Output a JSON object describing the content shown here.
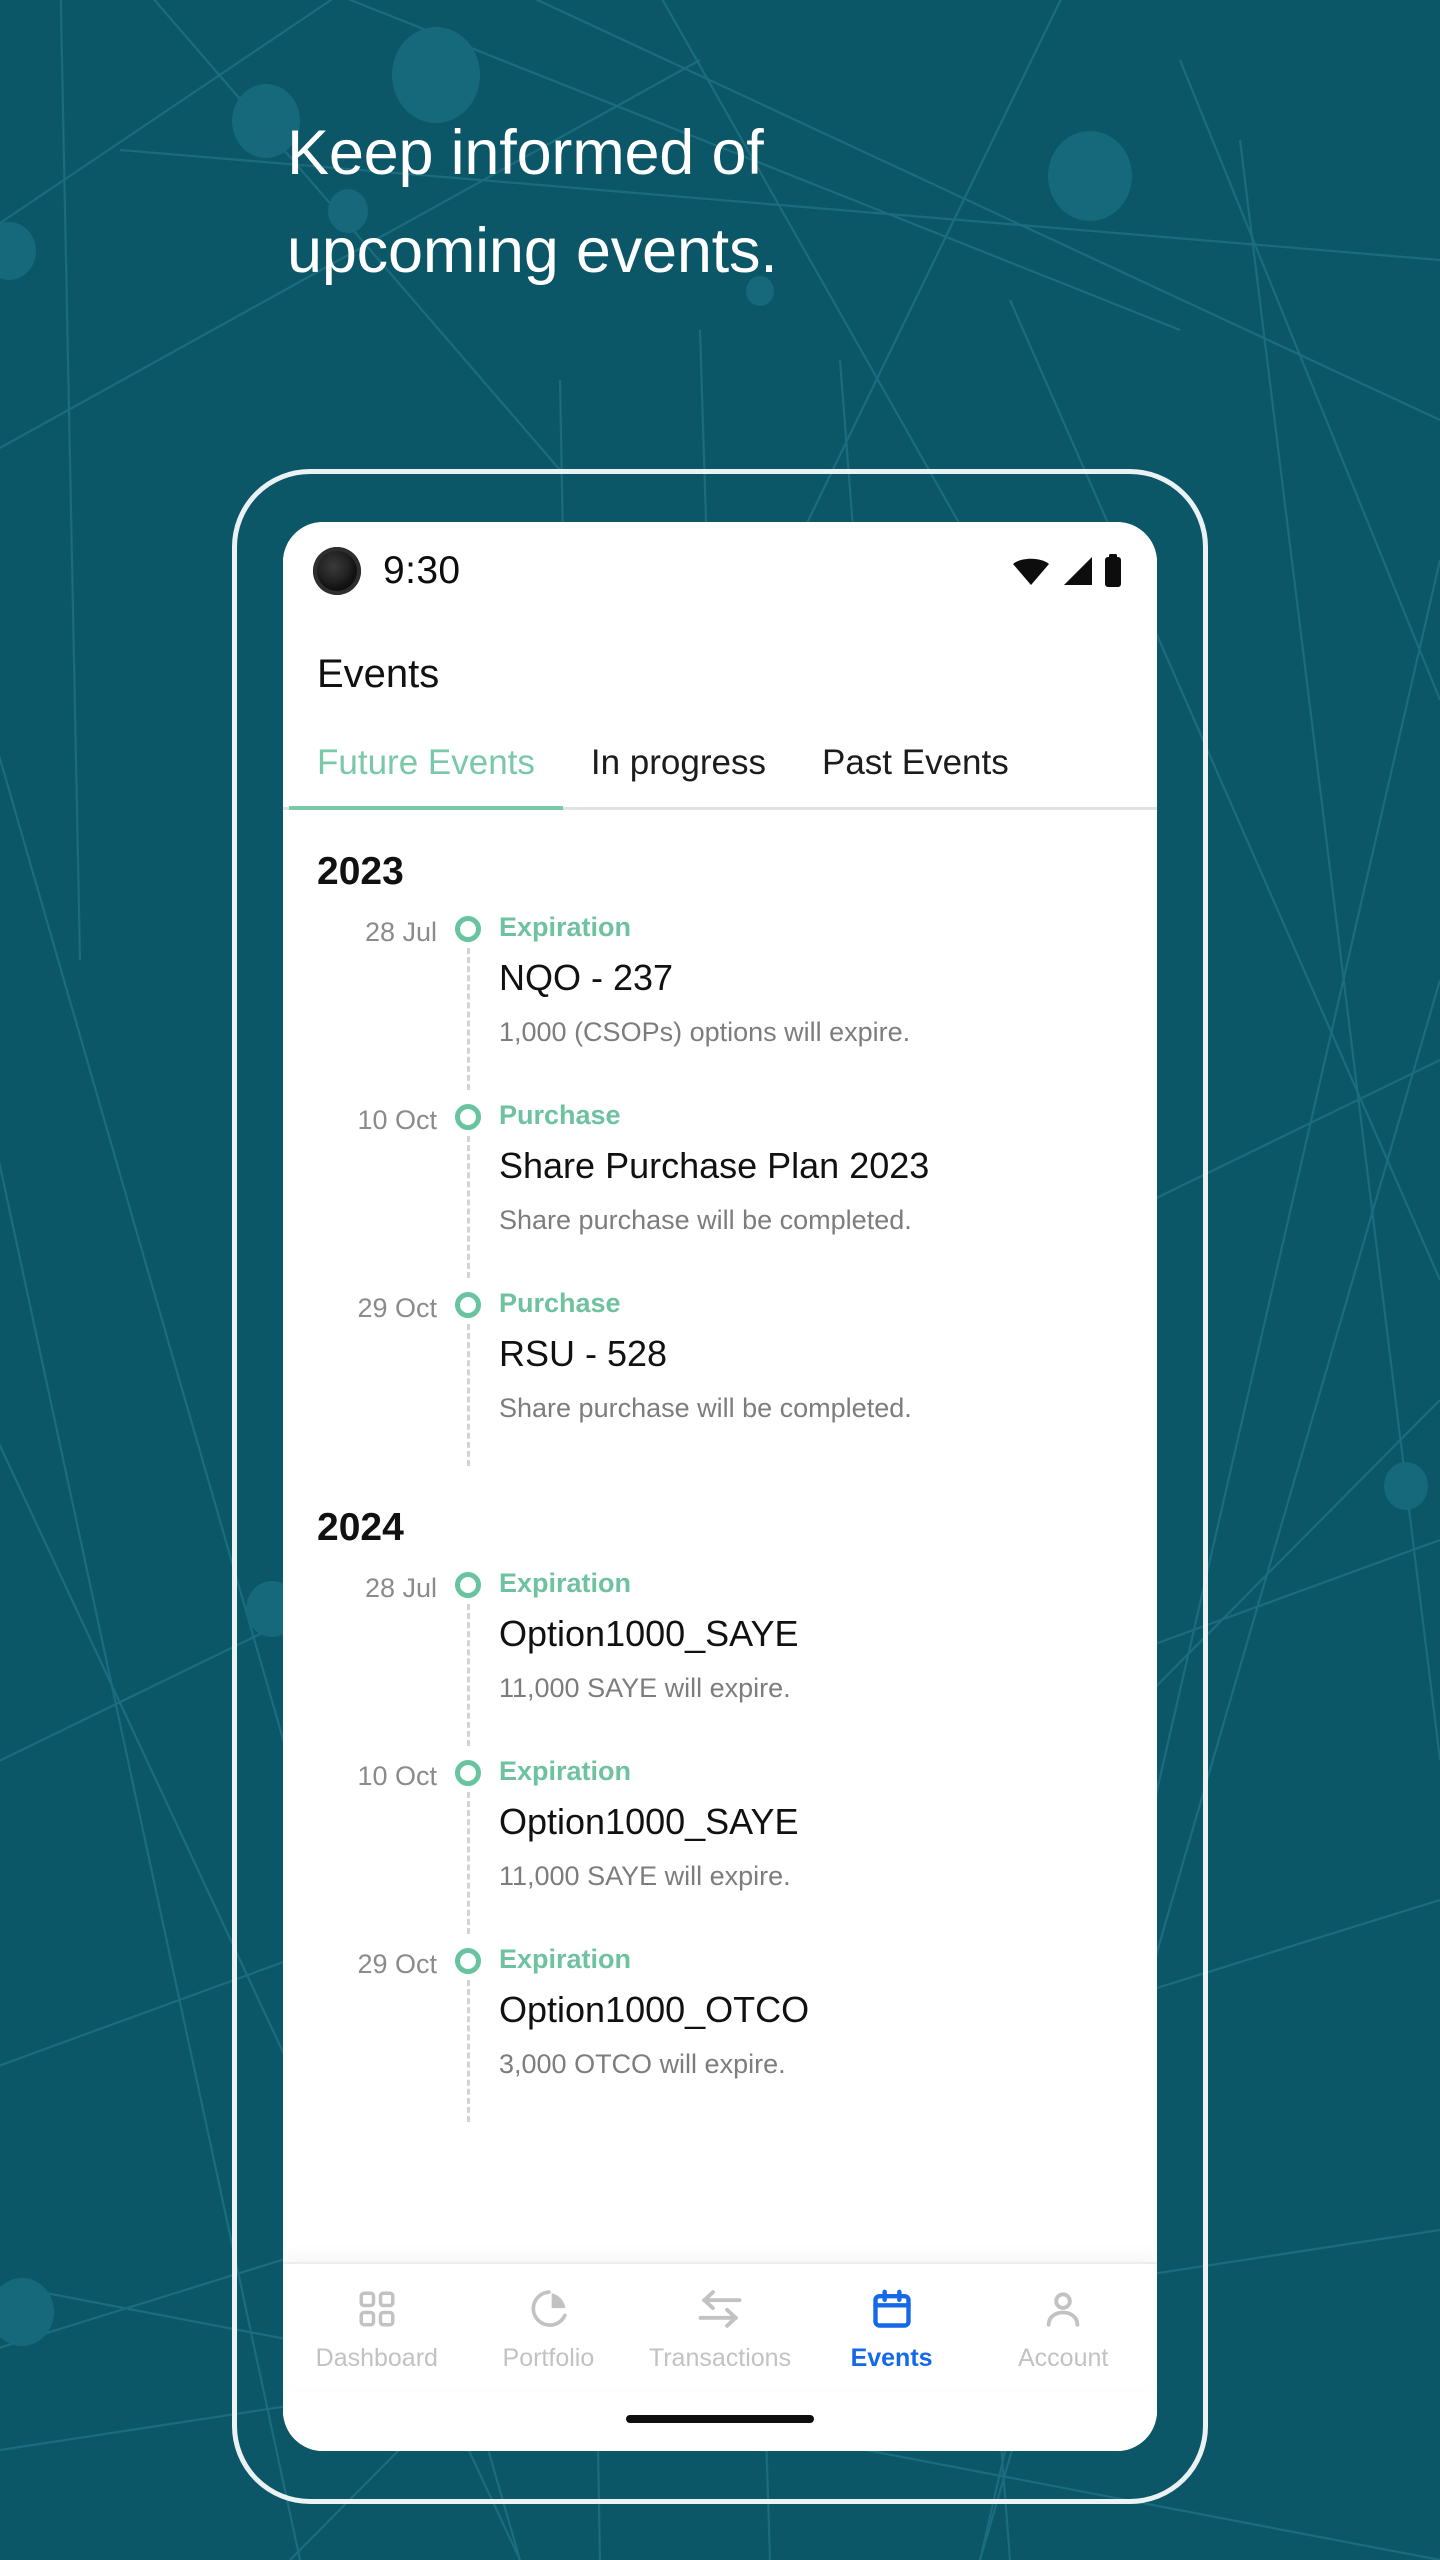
{
  "theme": {
    "background_teal": "#0b5768",
    "network_line": "#1d6e80",
    "accent_green": "#6fc2a0",
    "accent_blue": "#1569e8",
    "muted_gray": "#8b8b8b"
  },
  "hero": {
    "line1": "Keep informed of",
    "line2": "upcoming events."
  },
  "status_bar": {
    "time": "9:30",
    "icons": [
      "wifi-icon",
      "cellular-signal-icon",
      "battery-icon"
    ]
  },
  "header": {
    "title": "Events"
  },
  "tabs": [
    {
      "label": "Future Events",
      "active": true
    },
    {
      "label": "In progress",
      "active": false
    },
    {
      "label": "Past Events",
      "active": false
    }
  ],
  "timeline": [
    {
      "year": "2023",
      "events": [
        {
          "date": "28 Jul",
          "category": "Expiration",
          "title": "NQO - 237",
          "description": "1,000 (CSOPs) options will expire."
        },
        {
          "date": "10 Oct",
          "category": "Purchase",
          "title": "Share Purchase Plan 2023",
          "description": "Share purchase will be completed."
        },
        {
          "date": "29 Oct",
          "category": "Purchase",
          "title": "RSU - 528",
          "description": "Share purchase will be completed."
        }
      ]
    },
    {
      "year": "2024",
      "events": [
        {
          "date": "28 Jul",
          "category": "Expiration",
          "title": "Option1000_SAYE",
          "description": "11,000 SAYE will expire."
        },
        {
          "date": "10 Oct",
          "category": "Expiration",
          "title": "Option1000_SAYE",
          "description": "11,000 SAYE will expire."
        },
        {
          "date": "29 Oct",
          "category": "Expiration",
          "title": "Option1000_OTCO",
          "description": "3,000 OTCO will expire."
        }
      ]
    }
  ],
  "bottom_nav": [
    {
      "label": "Dashboard",
      "icon": "grid-icon",
      "active": false
    },
    {
      "label": "Portfolio",
      "icon": "pie-chart-icon",
      "active": false
    },
    {
      "label": "Transactions",
      "icon": "transfer-arrows-icon",
      "active": false
    },
    {
      "label": "Events",
      "icon": "calendar-icon",
      "active": true
    },
    {
      "label": "Account",
      "icon": "person-icon",
      "active": false
    }
  ]
}
